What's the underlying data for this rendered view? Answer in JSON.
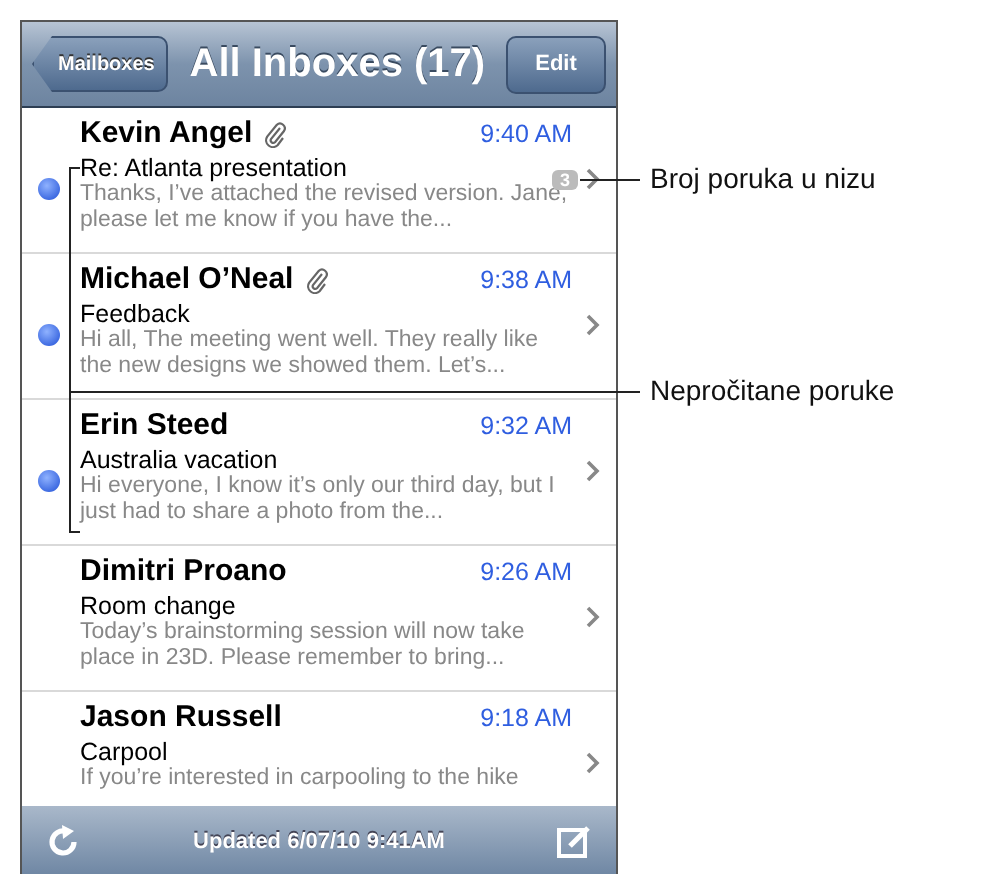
{
  "nav": {
    "back": "Mailboxes",
    "title": "All Inboxes (17)",
    "edit": "Edit"
  },
  "messages": [
    {
      "sender": "Kevin Angel",
      "time": "9:40 AM",
      "subject": "Re: Atlanta presentation",
      "preview": "Thanks, I’ve attached the revised version. Jane, please let me know if you have the...",
      "unread": true,
      "attachment": true,
      "thread_count": "3"
    },
    {
      "sender": "Michael O’Neal",
      "time": "9:38 AM",
      "subject": "Feedback",
      "preview": "Hi all, The meeting went well. They really like the new designs we showed them. Let’s...",
      "unread": true,
      "attachment": true
    },
    {
      "sender": "Erin Steed",
      "time": "9:32 AM",
      "subject": "Australia vacation",
      "preview": "Hi everyone, I know it’s only our third day, but I just had to share a photo from the...",
      "unread": true,
      "attachment": false
    },
    {
      "sender": "Dimitri Proano",
      "time": "9:26 AM",
      "subject": "Room change",
      "preview": "Today’s brainstorming session will now take place in 23D. Please remember to bring...",
      "unread": false,
      "attachment": false
    },
    {
      "sender": "Jason Russell",
      "time": "9:18 AM",
      "subject": "Carpool",
      "preview": "If you’re interested in carpooling to the hike",
      "unread": false,
      "attachment": false
    }
  ],
  "toolbar": {
    "status": "Updated 6/07/10 9:41AM"
  },
  "callouts": [
    {
      "text": "Broj poruka u nizu"
    },
    {
      "text": "Nepročitane poruke"
    }
  ]
}
